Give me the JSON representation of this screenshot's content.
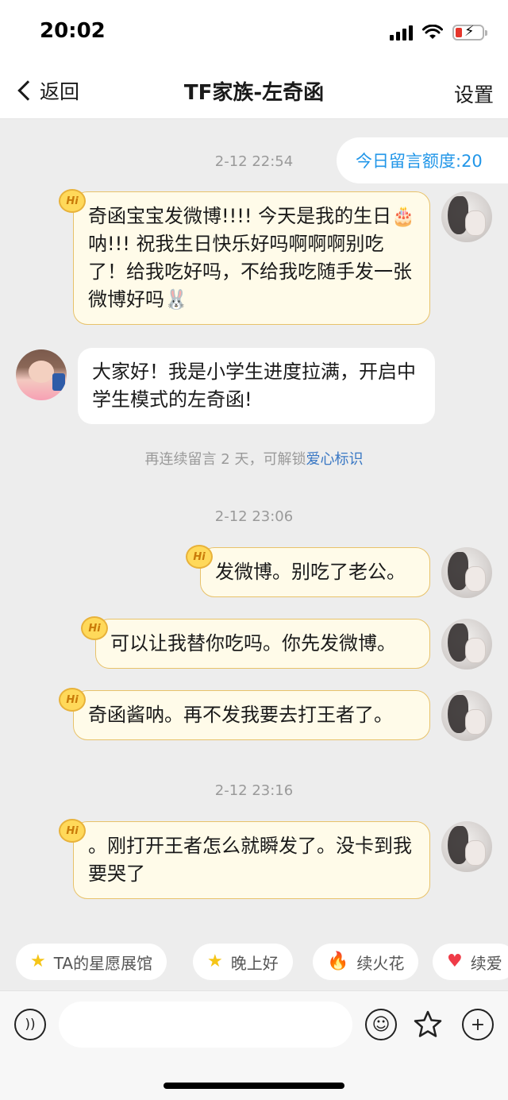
{
  "status_bar": {
    "time": "20:02"
  },
  "nav": {
    "back_label": "返回",
    "title": "TF家族-左奇函",
    "settings_label": "设置"
  },
  "quota": {
    "label": "今日留言额度:20"
  },
  "timestamps": [
    "2-12 22:54",
    "2-12 23:06",
    "2-12 23:16"
  ],
  "messages": [
    {
      "sender": "me",
      "text": "奇函宝宝发微博!!!! 今天是我的生日🎂呐!!! 祝我生日快乐好吗啊啊啊别吃了！给我吃好吗，不给我吃随手发一张微博好吗🐰"
    },
    {
      "sender": "other",
      "text": "大家好！我是小学生进度拉满，开启中学生模式的左奇函!"
    },
    {
      "sender": "me",
      "text": "发微博。别吃了老公。"
    },
    {
      "sender": "me",
      "text": "可以让我替你吃吗。你先发微博。"
    },
    {
      "sender": "me",
      "text": "奇函酱呐。再不发我要去打王者了。"
    },
    {
      "sender": "me",
      "text": "。刚打开王者怎么就瞬发了。没卡到我要哭了"
    }
  ],
  "hi_badge": "Hi",
  "system_tip": {
    "text": "再连续留言 2 天，可解锁",
    "link": "爱心标识"
  },
  "chips": [
    {
      "label": "TA的星愿展馆",
      "icon": "star-icon"
    },
    {
      "label": "晚上好",
      "icon": "star-icon"
    },
    {
      "label": "续火花",
      "icon": "flame-icon"
    },
    {
      "label": "续爱",
      "icon": "heart-icon"
    }
  ],
  "input": {
    "value": "",
    "placeholder": ""
  },
  "colors": {
    "background": "#ededed",
    "my_bubble": "#fffbe9",
    "my_bubble_border": "#e8c26a",
    "link": "#3a78c4",
    "quota_text": "#2196e8"
  }
}
